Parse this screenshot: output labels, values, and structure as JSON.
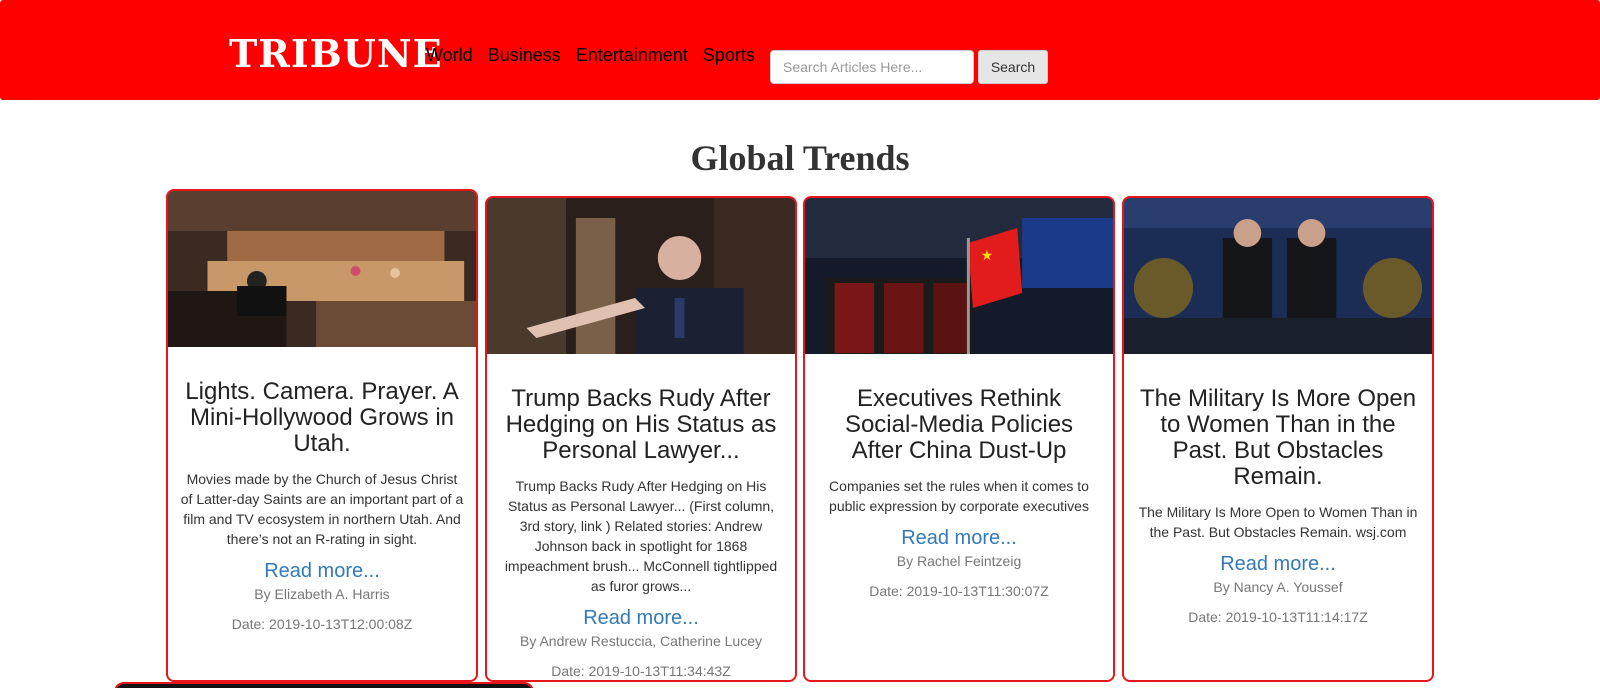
{
  "brand": "TRIBUNE",
  "nav": [
    "World",
    "Business",
    "Entertainment",
    "Sports"
  ],
  "search": {
    "placeholder": "Search Articles Here...",
    "button": "Search"
  },
  "section_title": "Global Trends",
  "articles": [
    {
      "title": "Lights. Camera. Prayer. A Mini-Hollywood Grows in Utah.",
      "description": "Movies made by the Church of Jesus Christ of Latter-day Saints are an important part of a film and TV ecosystem in northern Utah. And there’s not an R-rating in sight.",
      "read_more": "Read more...",
      "author": "By Elizabeth A. Harris",
      "date": "Date: 2019-10-13T12:00:08Z"
    },
    {
      "title": "Trump Backs Rudy After Hedging on His Status as Personal Lawyer...",
      "description": "Trump Backs Rudy After Hedging on His Status as Personal Lawyer... (First column, 3rd story, link ) Related stories: Andrew Johnson back in spotlight for 1868 impeachment brush... McConnell tightlipped as furor grows...",
      "read_more": "Read more...",
      "author": "By Andrew Restuccia, Catherine Lucey",
      "date": "Date: 2019-10-13T11:34:43Z"
    },
    {
      "title": "Executives Rethink Social-Media Policies After China Dust-Up",
      "description": "Companies set the rules when it comes to public expression by corporate executives",
      "read_more": "Read more...",
      "author": "By Rachel Feintzeig",
      "date": "Date: 2019-10-13T11:30:07Z"
    },
    {
      "title": "The Military Is More Open to Women Than in the Past. But Obstacles Remain.",
      "description": "The Military Is More Open to Women Than in the Past. But Obstacles Remain. wsj.com",
      "read_more": "Read more...",
      "author": "By Nancy A. Youssef",
      "date": "Date: 2019-10-13T11:14:17Z"
    }
  ],
  "colors": {
    "navbar": "#ff0000",
    "card_border": "#e8161b",
    "link": "#337ab7"
  }
}
